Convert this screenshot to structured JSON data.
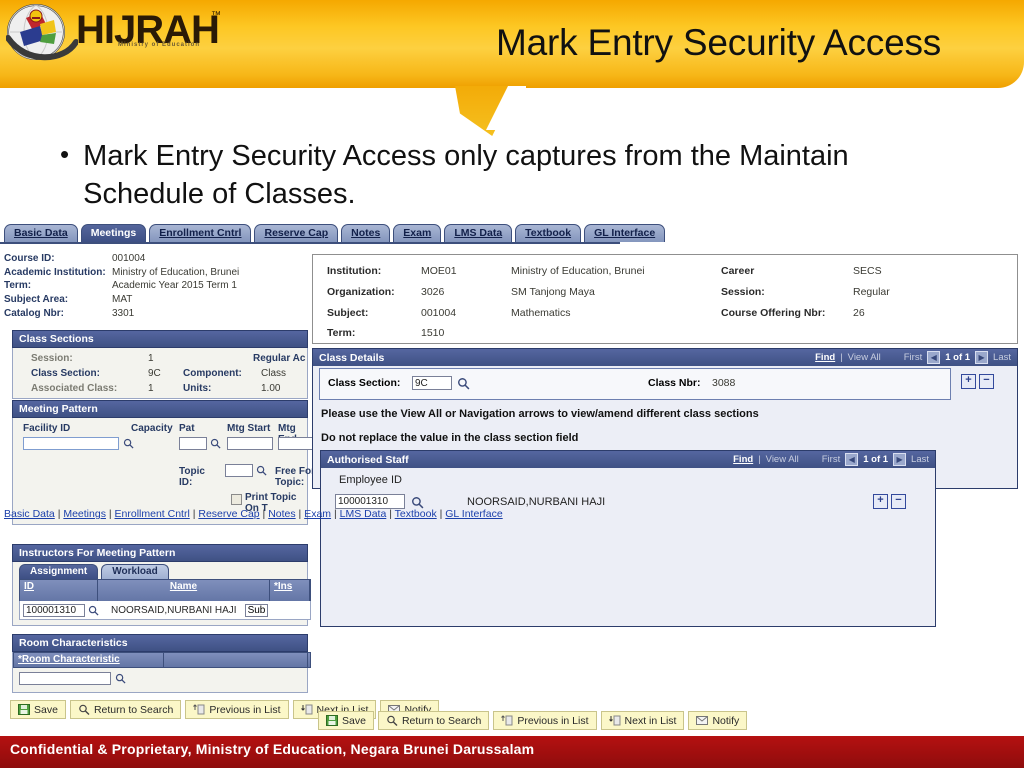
{
  "slide": {
    "title": "Mark Entry Security Access",
    "bullet": "Mark Entry Security Access only captures from the Maintain Schedule of Classes.",
    "bullet_marker": "•",
    "logo": {
      "name": "HIJRAH",
      "tm": "™",
      "tagline": "Ministry of Education"
    },
    "footer": "Confidential & Proprietary, Ministry of Education, Negara Brunei Darussalam"
  },
  "app": {
    "tabs": [
      {
        "label": "Basic Data",
        "active": false
      },
      {
        "label": "Meetings",
        "active": true
      },
      {
        "label": "Enrollment Cntrl",
        "active": false
      },
      {
        "label": "Reserve Cap",
        "active": false
      },
      {
        "label": "Notes",
        "active": false
      },
      {
        "label": "Exam",
        "active": false
      },
      {
        "label": "LMS Data",
        "active": false
      },
      {
        "label": "Textbook",
        "active": false
      },
      {
        "label": "GL Interface",
        "active": false
      }
    ],
    "left": {
      "header_fields": [
        {
          "label": "Course ID:",
          "value": "001004"
        },
        {
          "label": "Academic Institution:",
          "value": "Ministry of Education, Brunei"
        },
        {
          "label": "Term:",
          "value": "Academic Year 2015 Term 1"
        },
        {
          "label": "Subject Area:",
          "value": "MAT"
        },
        {
          "label": "Catalog Nbr:",
          "value": "3301"
        }
      ],
      "class_sections": {
        "title": "Class Sections",
        "session_label": "Session:",
        "session_value": "1",
        "session_desc": "Regular Ac",
        "class_section_label": "Class Section:",
        "class_section_value": "9C",
        "component_label": "Component:",
        "component_value": "Class",
        "associated_class_label": "Associated Class:",
        "associated_class_value": "1",
        "units_label": "Units:",
        "units_value": "1.00"
      },
      "meeting_pattern": {
        "title": "Meeting Pattern",
        "facility_id_label": "Facility ID",
        "facility_id_value": "",
        "capacity_label": "Capacity",
        "capacity_value": "",
        "pat_label": "Pat",
        "pat_value": "",
        "mtg_start_label": "Mtg Start",
        "mtg_start_value": "",
        "mtg_end_label": "Mtg End",
        "mtg_end_value": "",
        "topic_id_label": "Topic ID:",
        "topic_id_value": "",
        "free_form_topic_label": "Free For Topic:",
        "print_topic_label": "Print Topic On T"
      },
      "instructors": {
        "title": "Instructors For Meeting Pattern",
        "subtabs": [
          {
            "label": "Assignment",
            "active": true
          },
          {
            "label": "Workload",
            "active": false
          }
        ],
        "columns": [
          "ID",
          "Name",
          "*Ins"
        ],
        "row": {
          "id": "100001310",
          "name": "NOORSAID,NURBANI HAJI",
          "role": "Sub"
        }
      },
      "room_characteristics": {
        "title": "Room Characteristics",
        "column": "*Room Characteristic",
        "value": ""
      }
    },
    "right": {
      "header": {
        "institution_label": "Institution:",
        "institution_code": "MOE01",
        "institution_desc": "Ministry of Education, Brunei",
        "organization_label": "Organization:",
        "organization_code": "3026",
        "organization_desc": "SM Tanjong Maya",
        "subject_label": "Subject:",
        "subject_code": "001004",
        "subject_desc": "Mathematics",
        "term_label": "Term:",
        "term_code": "1510",
        "career_label": "Career",
        "career_value": "SECS",
        "session_label": "Session:",
        "session_value": "Regular",
        "offering_label": "Course Offering Nbr:",
        "offering_value": "26"
      },
      "class_details": {
        "title": "Class Details",
        "find": "Find",
        "divider": "|",
        "view_all": "View All",
        "first": "First",
        "counter": "1 of 1",
        "last": "Last",
        "class_section_label": "Class Section:",
        "class_section_value": "9C",
        "class_nbr_label": "Class Nbr:",
        "class_nbr_value": "3088",
        "note1": "Please use the View All or Navigation arrows to view/amend different class sections",
        "note2": "Do not replace the value in the class section field",
        "add_btn": "+",
        "del_btn": "−"
      },
      "authorised_staff": {
        "title": "Authorised Staff",
        "find": "Find",
        "divider": "|",
        "view_all": "View All",
        "first": "First",
        "counter": "1 of 1",
        "last": "Last",
        "employee_id_label": "Employee ID",
        "employee_id_value": "100001310",
        "employee_name": "NOORSAID,NURBANI HAJI",
        "add_btn": "+",
        "del_btn": "−"
      }
    },
    "toolbar": [
      {
        "label": "Save",
        "icon": "save-icon"
      },
      {
        "label": "Return to Search",
        "icon": "search-icon"
      },
      {
        "label": "Previous in List",
        "icon": "previous-icon"
      },
      {
        "label": "Next in List",
        "icon": "next-icon"
      },
      {
        "label": "Notify",
        "icon": "notify-icon"
      }
    ],
    "bottom_links": [
      "Basic Data",
      "Meetings",
      "Enrollment Cntrl",
      "Reserve Cap",
      "Notes",
      "Exam",
      "LMS Data",
      "Textbook",
      "GL Interface"
    ],
    "link_separator": " | "
  },
  "colors": {
    "header_gradient_start": "#f5a800",
    "header_gradient_end": "#fdd040",
    "panel_header_blue": "#3f5184",
    "grid_header_blue": "#6375a5",
    "button_yellow": "#fbf7c8",
    "footer_red": "#b51111",
    "link_blue": "#1b3faa"
  }
}
